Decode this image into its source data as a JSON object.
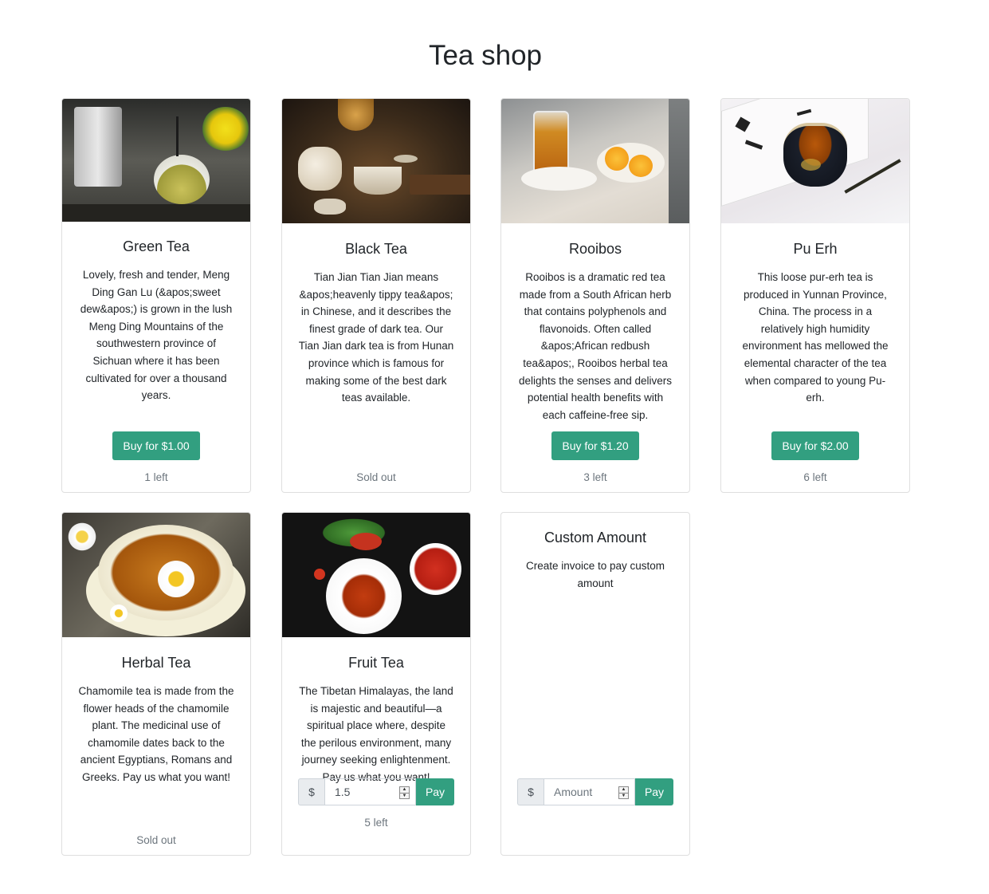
{
  "page": {
    "title": "Tea shop"
  },
  "colors": {
    "accent": "#329f80",
    "muted": "#6c757d",
    "border": "#dfdfdf"
  },
  "items": [
    {
      "title": "Green Tea",
      "description": "Lovely, fresh and tender, Meng Ding Gan Lu (&apos;sweet dew&apos;) is grown in the lush Meng Ding Mountains of the southwestern province of Sichuan where it has been cultivated for over a thousand years.",
      "button": "Buy for $1.00",
      "stock": "1 left"
    },
    {
      "title": "Black Tea",
      "description": "Tian Jian Tian Jian means &apos;heavenly tippy tea&apos; in Chinese, and it describes the finest grade of dark tea. Our Tian Jian dark tea is from Hunan province which is famous for making some of the best dark teas available.",
      "stock": "Sold out"
    },
    {
      "title": "Rooibos",
      "description": "Rooibos is a dramatic red tea made from a South African herb that contains polyphenols and flavonoids. Often called &apos;African redbush tea&apos;, Rooibos herbal tea delights the senses and delivers potential health benefits with each caffeine-free sip.",
      "button": "Buy for $1.20",
      "stock": "3 left"
    },
    {
      "title": "Pu Erh",
      "description": "This loose pur-erh tea is produced in Yunnan Province, China. The process in a relatively high humidity environment has mellowed the elemental character of the tea when compared to young Pu-erh.",
      "button": "Buy for $2.00",
      "stock": "6 left"
    },
    {
      "title": "Herbal Tea",
      "description": "Chamomile tea is made from the flower heads of the chamomile plant. The medicinal use of chamomile dates back to the ancient Egyptians, Romans and Greeks. Pay us what you want!",
      "stock": "Sold out"
    },
    {
      "title": "Fruit Tea",
      "description": "The Tibetan Himalayas, the land is majestic and beautiful—a spiritual place where, despite the perilous environment, many journey seeking enlightenment. Pay us what you want!",
      "currency": "$",
      "amount": "1.5",
      "pay_button": "Pay",
      "stock": "5 left"
    }
  ],
  "custom": {
    "title": "Custom Amount",
    "description": "Create invoice to pay custom amount",
    "currency": "$",
    "placeholder": "Amount",
    "pay_button": "Pay"
  },
  "icons": {
    "spinner_up": "▲",
    "spinner_down": "▼"
  }
}
